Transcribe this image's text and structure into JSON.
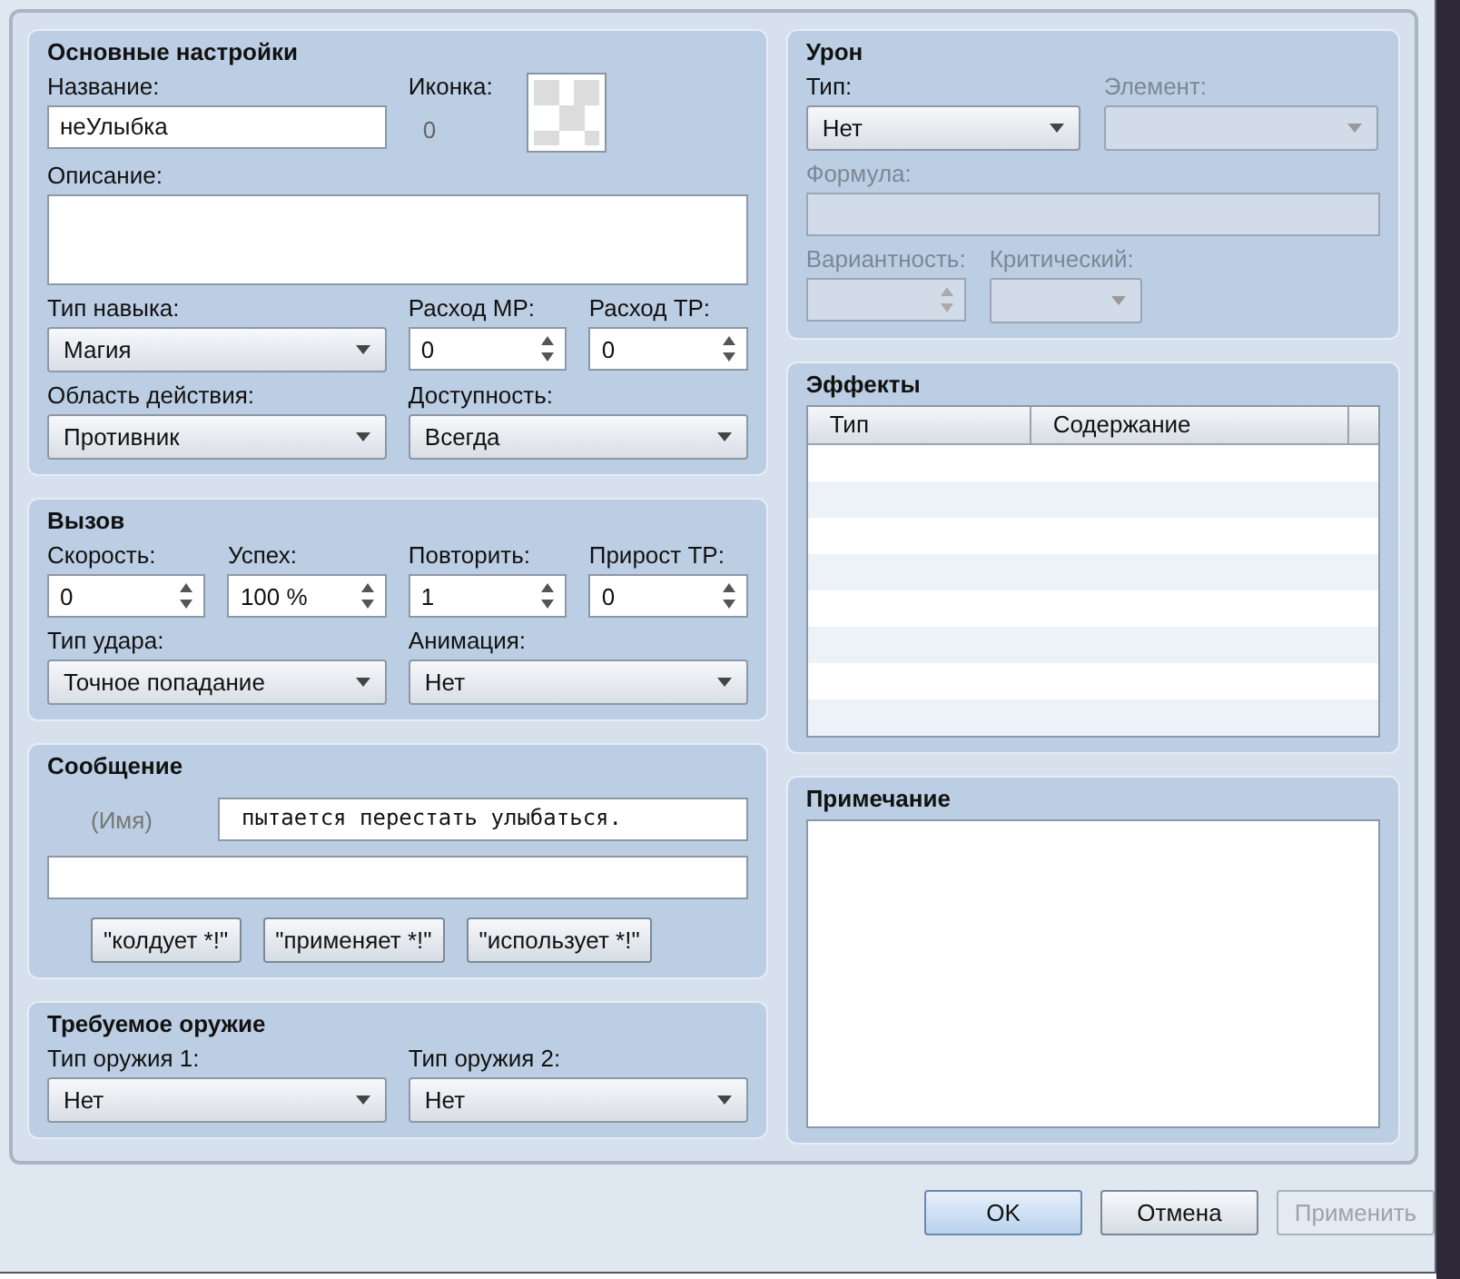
{
  "basic": {
    "title": "Основные настройки",
    "fields": [
      {
        "kind": "text",
        "label": "Название:",
        "value": "неУлыбка"
      },
      {
        "kind": "icon",
        "label": "Иконка:",
        "value": "0"
      },
      {
        "kind": "textarea",
        "label": "Описание:"
      },
      {
        "kind": "select",
        "label": "Тип навыка:",
        "value": "Магия"
      },
      {
        "kind": "spin",
        "label": "Расход MP:",
        "value": "0"
      },
      {
        "kind": "spin",
        "label": "Расход TP:",
        "value": "0"
      },
      {
        "kind": "select",
        "label": "Область действия:",
        "value": "Противник"
      },
      {
        "kind": "select",
        "label": "Доступность:",
        "value": "Всегда"
      }
    ]
  },
  "invocation": {
    "title": "Вызов",
    "fields": [
      {
        "kind": "spin",
        "label": "Скорость:",
        "value": "0"
      },
      {
        "kind": "spin",
        "label": "Успех:",
        "value": "100 %"
      },
      {
        "kind": "spin",
        "label": "Повторить:",
        "value": "1"
      },
      {
        "kind": "spin",
        "label": "Прирост TP:",
        "value": "0"
      },
      {
        "kind": "select",
        "label": "Тип удара:",
        "value": "Точное попадание"
      },
      {
        "kind": "select",
        "label": "Анимация:",
        "value": "Нет"
      }
    ]
  },
  "message": {
    "title": "Сообщение",
    "name_hint": "(Имя)",
    "line1": "пытается перестать улыбаться.",
    "buttons": [
      "\"колдует *!\"",
      "\"применяет *!\"",
      "\"использует *!\""
    ]
  },
  "weapons": {
    "title": "Требуемое оружие",
    "fields": [
      {
        "kind": "select",
        "label": "Тип оружия 1:",
        "value": "Нет"
      },
      {
        "kind": "select",
        "label": "Тип оружия 2:",
        "value": "Нет"
      }
    ]
  },
  "damage": {
    "title": "Урон",
    "fields": [
      {
        "kind": "select",
        "label": "Тип:",
        "value": "Нет",
        "disabled": false
      },
      {
        "kind": "select",
        "label": "Элемент:",
        "disabled": true
      },
      {
        "kind": "line",
        "label": "Формула:",
        "disabled": true
      },
      {
        "kind": "spin",
        "label": "Вариантность:",
        "disabled": true
      },
      {
        "kind": "combo",
        "label": "Критический:",
        "disabled": true
      }
    ]
  },
  "effects": {
    "title": "Эффекты",
    "columns": [
      "Тип",
      "Содержание"
    ]
  },
  "note": {
    "title": "Примечание"
  },
  "buttons": [
    {
      "label": "OK",
      "disabled": false,
      "default": true
    },
    {
      "label": "Отмена",
      "disabled": false,
      "default": false
    },
    {
      "label": "Применить",
      "disabled": true,
      "default": false
    }
  ]
}
